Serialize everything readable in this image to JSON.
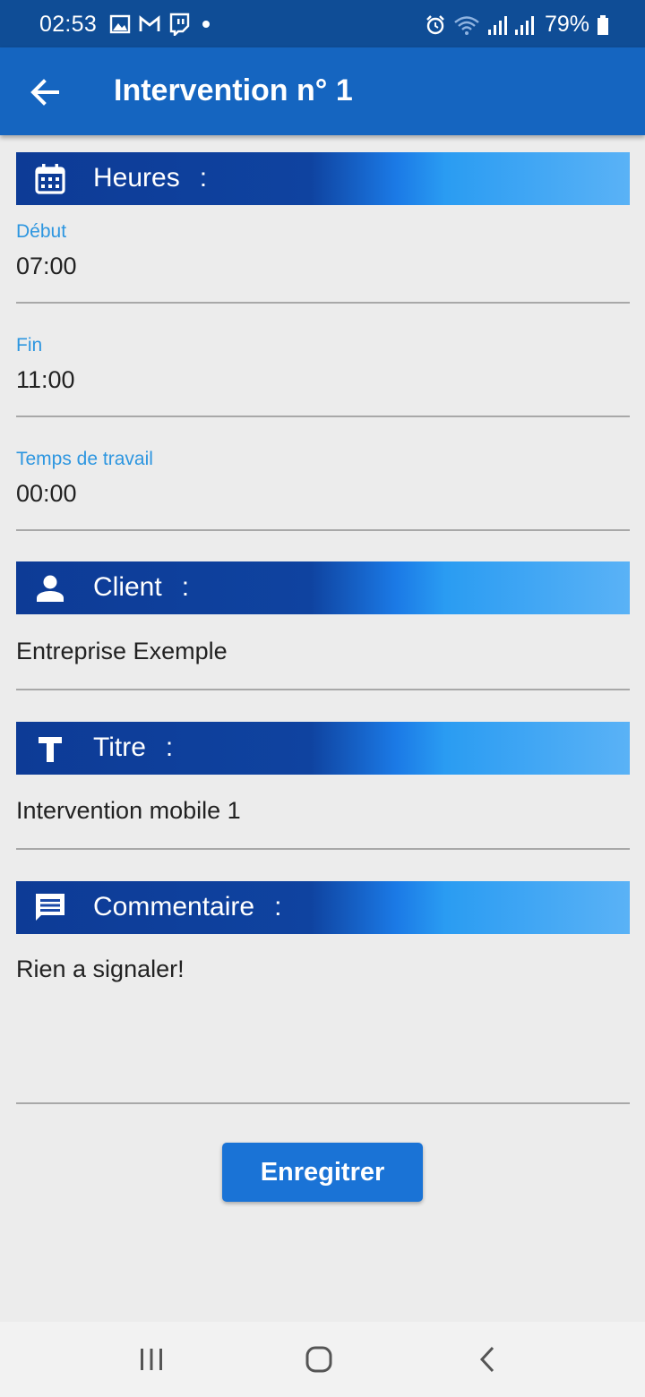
{
  "status_bar": {
    "time": "02:53",
    "battery": "79%",
    "icons": [
      "image-icon",
      "gmail-icon",
      "twitch-icon",
      "dot-icon",
      "alarm-icon",
      "wifi-icon",
      "signal-icon",
      "signal-icon",
      "battery-icon"
    ]
  },
  "app_bar": {
    "title": "Intervention n° 1",
    "back_icon": "arrow-left-icon"
  },
  "sections": {
    "heures": {
      "label": "Heures",
      "colon": ":",
      "icon": "calendar-icon"
    },
    "client": {
      "label": "Client",
      "colon": ":",
      "icon": "person-icon"
    },
    "titre": {
      "label": "Titre",
      "colon": ":",
      "icon": "text-t-icon"
    },
    "commentaire": {
      "label": "Commentaire",
      "colon": ":",
      "icon": "comment-icon"
    }
  },
  "fields": {
    "debut": {
      "label": "Début",
      "value": "07:00"
    },
    "fin": {
      "label": "Fin",
      "value": "11:00"
    },
    "temps": {
      "label": "Temps de travail",
      "value": "00:00"
    },
    "client": {
      "value": "Entreprise Exemple"
    },
    "titre": {
      "value": "Intervention mobile 1"
    },
    "commentaire": {
      "value": "Rien a signaler!"
    }
  },
  "actions": {
    "save_label": "Enregitrer"
  },
  "nav_bar": {
    "icons": [
      "recent-apps-icon",
      "home-icon",
      "back-icon"
    ]
  },
  "colors": {
    "status_bar": "#0f4d96",
    "app_bar": "#1565c0",
    "accent": "#2d96e0",
    "button": "#1a73d6",
    "background": "#ececec"
  }
}
